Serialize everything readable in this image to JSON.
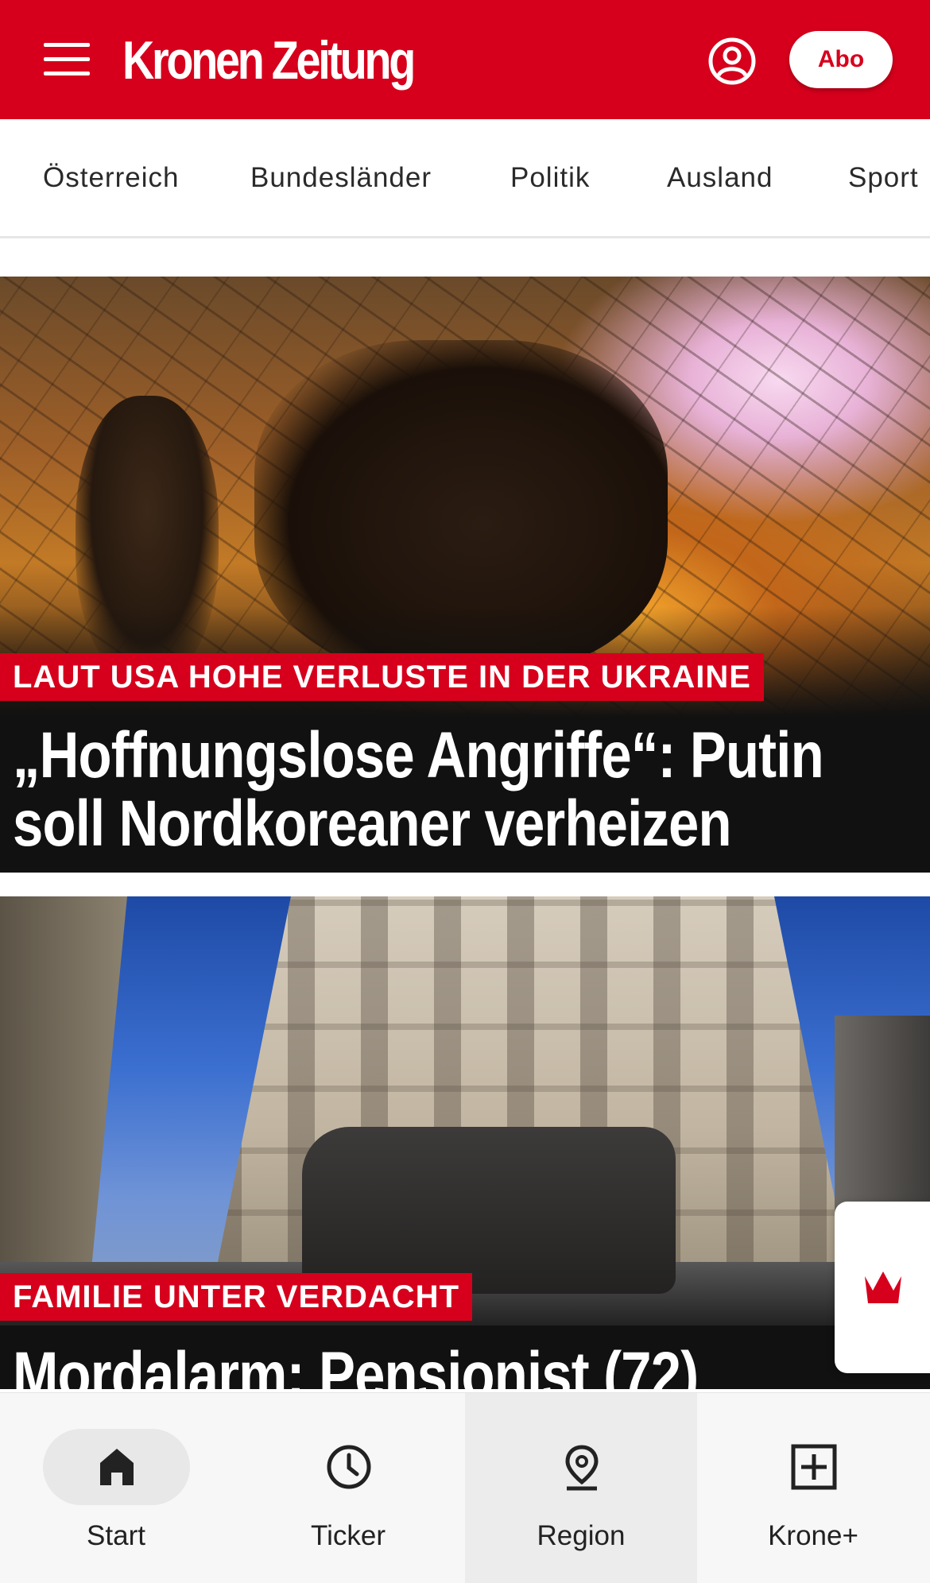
{
  "header": {
    "logo_text": "Kronen Zeitung",
    "abo_label": "Abo",
    "brand_color": "#d6001c"
  },
  "categories": [
    {
      "label": "Österreich"
    },
    {
      "label": "Bundesländer"
    },
    {
      "label": "Politik"
    },
    {
      "label": "Ausland"
    },
    {
      "label": "Sport"
    }
  ],
  "articles": [
    {
      "kicker": "LAUT USA HOHE VERLUSTE IN DER UKRAINE",
      "headline_line1": "„Hoffnungslose Angriffe“: Putin",
      "headline_line2": "soll Nordkoreaner verheizen"
    },
    {
      "kicker": "FAMILIE UNTER VERDACHT",
      "headline_line1": "Mordalarm: Pensionist (72)"
    }
  ],
  "bottom_nav": [
    {
      "label": "Start",
      "icon": "home-icon",
      "active": true
    },
    {
      "label": "Ticker",
      "icon": "clock-icon"
    },
    {
      "label": "Region",
      "icon": "location-pin-icon"
    },
    {
      "label": "Krone+",
      "icon": "plus-box-icon"
    }
  ]
}
